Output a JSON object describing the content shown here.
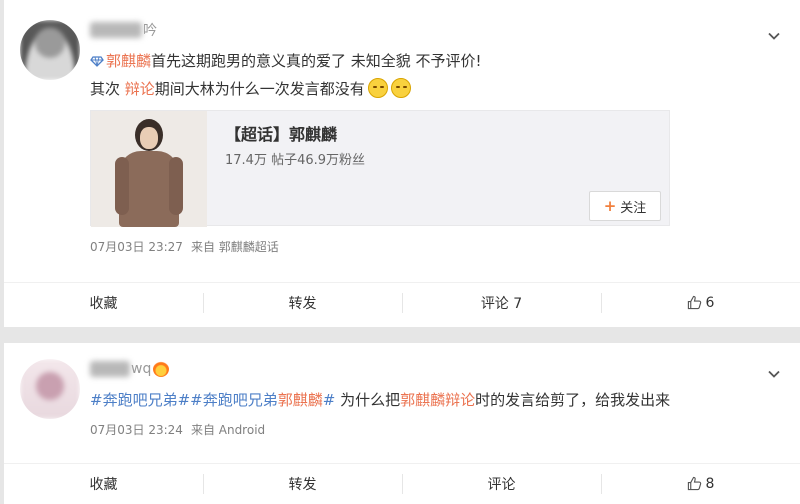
{
  "post1": {
    "username_tail": "吟",
    "line1": {
      "link": "郭麒麟",
      "rest": "首先这期跑男的意义真的爱了 未知全貌 不予评价!"
    },
    "line2": {
      "pre": "其次 ",
      "highlight": "辩论",
      "post": "期间大林为什么一次发言都没有"
    },
    "embed": {
      "title": "【超话】郭麒麟",
      "stats": "17.4万 帖子46.9万粉丝",
      "follow_label": "关注"
    },
    "meta": {
      "time": "07月03日 23:27",
      "source": "来自 郭麒麟超话"
    },
    "actions": {
      "favorite": "收藏",
      "repost": "转发",
      "comment": "评论 7",
      "like": "6"
    }
  },
  "post2": {
    "username_tail": "wq",
    "line1": {
      "topic1": "#奔跑吧兄弟#",
      "topic2_a": "#奔跑吧兄弟",
      "topic2_b": "郭麒麟",
      "topic2_c": "#",
      "pre": " 为什么把",
      "hl": "郭麒麟辩论",
      "post": "时的发言给剪了，给我发出来"
    },
    "meta": {
      "time": "07月03日 23:24",
      "source": "来自 Android"
    },
    "actions": {
      "favorite": "收藏",
      "repost": "转发",
      "comment": "评论",
      "like": "8"
    }
  },
  "colors": {
    "highlight": "#eb7350",
    "topic": "#4d7fc7",
    "text": "#333333",
    "meta": "#808080"
  },
  "icons": [
    "chevron-down-icon",
    "super-topic-diamond-icon",
    "emoji-icon",
    "plus-icon",
    "thumb-up-icon",
    "flame-badge-icon"
  ]
}
